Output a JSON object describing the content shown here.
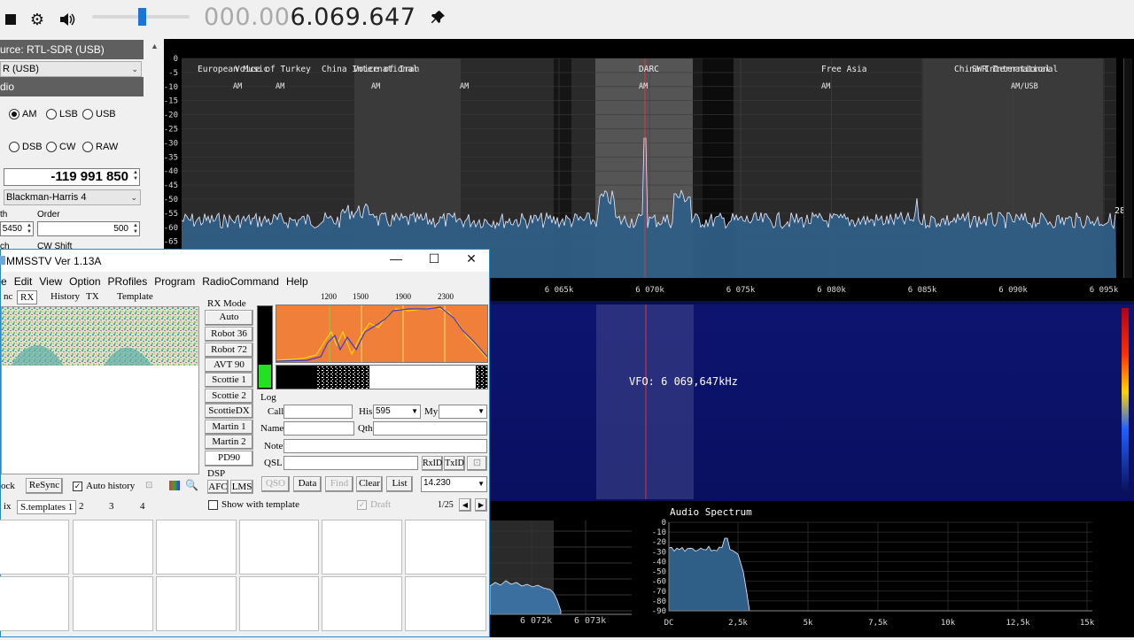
{
  "toolbar": {
    "stop_icon": "stop-icon",
    "gear_icon": "gear-icon",
    "volume_icon": "speaker-icon",
    "volume_level": 0.5,
    "frequency_dim": "000.00",
    "frequency_bright": "6.069.647",
    "pin_icon": "pin-icon"
  },
  "left_panel": {
    "source_header": "urce: RTL-SDR (USB)",
    "source_select": "R (USB)",
    "radio_header": "dio",
    "modes": [
      "AM",
      "LSB",
      "USB",
      "DSB",
      "CW",
      "RAW"
    ],
    "selected_mode": "AM",
    "shift_value": "-119 991 850",
    "filter_type": "Blackman-Harris 4",
    "bandwidth_label": "th",
    "order_label": "Order",
    "bandwidth_value": "5450",
    "order_value": "500",
    "squelch_label": "ch",
    "cw_shift_label": "CW Shift"
  },
  "spectrum": {
    "db_ticks": [
      "0",
      "-5",
      "-10",
      "-15",
      "-20",
      "-25",
      "-30",
      "-35",
      "-40",
      "-45",
      "-50",
      "-55",
      "-60",
      "-65"
    ],
    "freq_ticks": [
      "6 065k",
      "6 070k",
      "6 075k",
      "6 080k",
      "6 085k",
      "6 090k",
      "6 095k"
    ],
    "right_value": "28",
    "stations": [
      {
        "name": "European Music",
        "mode": "AM"
      },
      {
        "name": "Voice of Turkey",
        "mode": "AM"
      },
      {
        "name": "China International",
        "mode": "AM"
      },
      {
        "name": "Voice of Iran",
        "mode": "AM"
      },
      {
        "name": "DARC",
        "mode": "AM"
      },
      {
        "name": "Free Asia",
        "mode": "AM"
      },
      {
        "name": "China International",
        "mode": "AM/USB"
      },
      {
        "name": "SWR International",
        "mode": ""
      }
    ]
  },
  "waterfall": {
    "vfo_label": "VFO: 6 069,647kHz"
  },
  "zoom": {
    "freq_ticks": [
      "6 072k",
      "6 073k"
    ]
  },
  "audio": {
    "title": "Audio Spectrum",
    "db_ticks": [
      "0",
      "-10",
      "-20",
      "-30",
      "-40",
      "-50",
      "-60",
      "-70",
      "-80",
      "-90"
    ],
    "freq_ticks": [
      "DC",
      "2,5k",
      "5k",
      "7,5k",
      "10k",
      "12,5k",
      "15k"
    ]
  },
  "mmsstv": {
    "title": "MMSSTV Ver 1.13A",
    "minimize": "—",
    "maximize": "☐",
    "close": "✕",
    "menu": [
      "e",
      "Edit",
      "View",
      "Option",
      "PRofiles",
      "Program",
      "RadioCommand",
      "Help"
    ],
    "tabs": [
      "nc",
      "RX",
      "History",
      "TX",
      "Template"
    ],
    "rx_mode_label": "RX Mode",
    "modes": [
      "Auto",
      "Robot 36",
      "Robot 72",
      "AVT 90",
      "Scottie 1",
      "Scottie 2",
      "ScottieDX",
      "Martin 1",
      "Martin 2",
      "PD90"
    ],
    "freq_labels": [
      "1200",
      "1500",
      "1900",
      "2300"
    ],
    "log_label": "Log",
    "call_label": "Call",
    "his_label": "His",
    "his_value": "595",
    "my_label": "My",
    "name_label": "Name",
    "qth_label": "Qth",
    "note_label": "Note",
    "qsl_label": "QSL",
    "rxid": "RxID",
    "txid": "TxID",
    "qso": "QSO",
    "data": "Data",
    "find": "Find",
    "clear": "Clear",
    "list": "List",
    "band_value": "14.230",
    "lock": "ock",
    "resync": "ReSync",
    "auto_history": "Auto history",
    "dsp_label": "DSP",
    "afc": "AFC",
    "lms": "LMS",
    "show_template": "Show with template",
    "draft": "Draft",
    "page_counter": "1/25",
    "bottom_tabs": [
      "ix",
      "S.templates 1",
      "2",
      "3",
      "4"
    ]
  }
}
